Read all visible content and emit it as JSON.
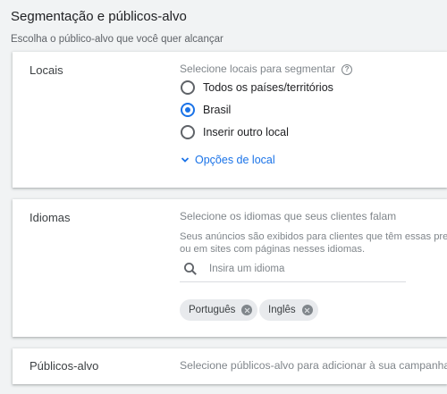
{
  "header": {
    "title": "Segmentação e públicos-alvo",
    "subtitle": "Escolha o público-alvo que você quer alcançar"
  },
  "locations": {
    "label": "Locais",
    "hint": "Selecione locais para segmentar",
    "help_icon": "help-circle-icon",
    "options": [
      {
        "label": "Todos os países/territórios",
        "selected": false
      },
      {
        "label": "Brasil",
        "selected": true
      },
      {
        "label": "Inserir outro local",
        "selected": false
      }
    ],
    "options_link": "Opções de local"
  },
  "languages": {
    "label": "Idiomas",
    "hint": "Selecione os idiomas que seus clientes falam",
    "description_line1": "Seus anúncios são exibidos para clientes que têm essas pref",
    "description_line2": "ou em sites com páginas nesses idiomas.",
    "search_placeholder": "Insira um idioma",
    "chips": [
      "Português",
      "Inglês"
    ]
  },
  "audiences": {
    "label": "Públicos-alvo",
    "hint": "Selecione públicos-alvo para adicionar à sua campanha"
  },
  "colors": {
    "accent": "#1a73e8",
    "background": "#f1f3f4",
    "card": "#ffffff"
  }
}
